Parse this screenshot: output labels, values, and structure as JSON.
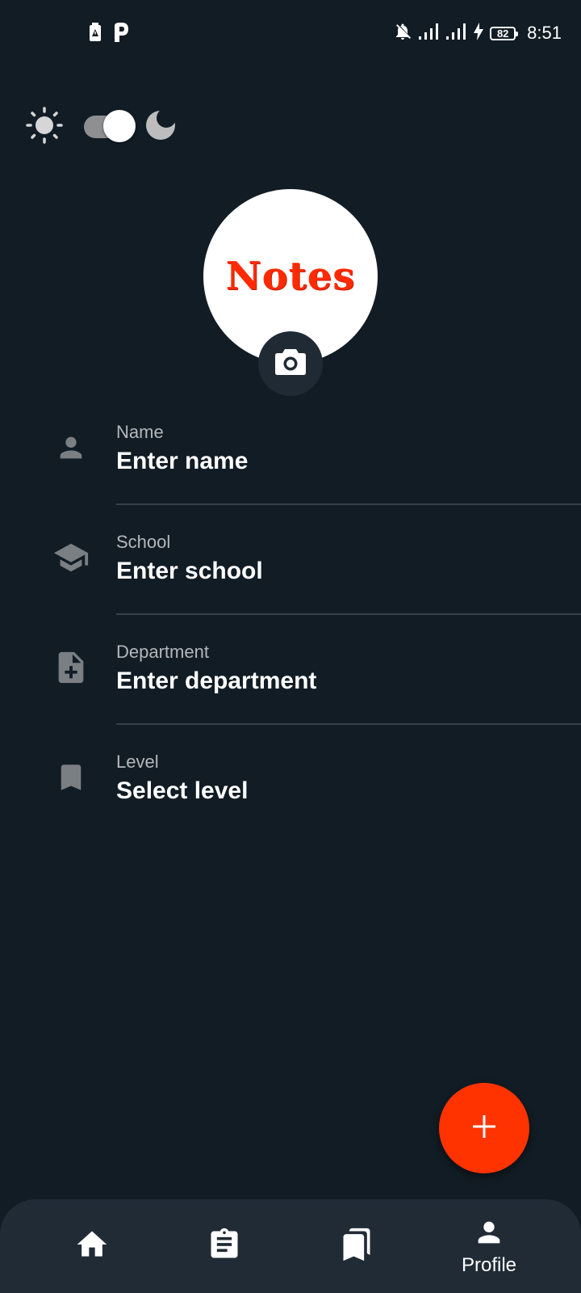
{
  "status_bar": {
    "time": "8:51",
    "battery_level": "82",
    "icons": [
      "battery-alert-icon",
      "p-app-icon",
      "bell-off-icon",
      "signal-icon",
      "signal-icon",
      "charging-icon",
      "battery-icon"
    ]
  },
  "theme": {
    "light_icon": "sun-icon",
    "dark_icon": "moon-icon",
    "dark_mode_on": true
  },
  "avatar": {
    "logo_text": "Notes",
    "logo_color": "#ff2a00",
    "camera_icon": "camera-icon"
  },
  "fields": [
    {
      "label": "Name",
      "value": "Enter name",
      "icon": "person-icon"
    },
    {
      "label": "School",
      "value": "Enter school",
      "icon": "school-icon"
    },
    {
      "label": "Department",
      "value": "Enter department",
      "icon": "note-add-icon"
    },
    {
      "label": "Level",
      "value": "Select level",
      "icon": "bookmark-icon"
    }
  ],
  "fab": {
    "icon": "plus-icon",
    "color": "#ff3300"
  },
  "bottom_nav": {
    "items": [
      {
        "icon": "home-icon",
        "label": ""
      },
      {
        "icon": "clipboard-icon",
        "label": ""
      },
      {
        "icon": "bookmarks-icon",
        "label": ""
      },
      {
        "icon": "person-icon",
        "label": "Profile",
        "active": true
      }
    ]
  },
  "colors": {
    "background": "#121c24",
    "nav_background": "#202b36",
    "accent": "#ff3300"
  }
}
